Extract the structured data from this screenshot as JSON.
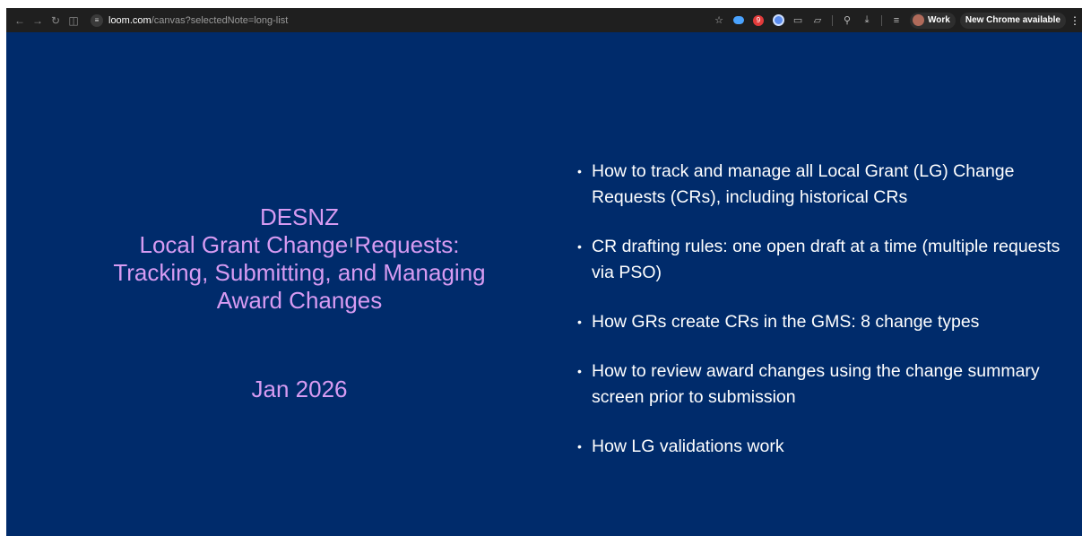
{
  "browser": {
    "url_host": "loom.com",
    "url_path": "/canvas?selectedNote=long-list",
    "profile_label": "Work",
    "update_label": "New Chrome available",
    "extension_badge": "9"
  },
  "slide": {
    "title_lines": [
      "DESNZ",
      "Local Grant Change Requests:",
      "Tracking, Submitting, and Managing",
      "Award Changes"
    ],
    "date": "Jan 2026",
    "bullets": [
      "How to track and manage all Local Grant (LG) Change Requests (CRs), including historical CRs",
      "CR drafting rules: one open draft at a time (multiple requests via PSO)",
      "How GRs create CRs in the GMS: 8 change types",
      "How to review award changes using the change summary screen prior to submission",
      "How LG validations work"
    ],
    "colors": {
      "background": "#002b6b",
      "title": "#d79bf2",
      "bullets": "#ffffff"
    }
  }
}
